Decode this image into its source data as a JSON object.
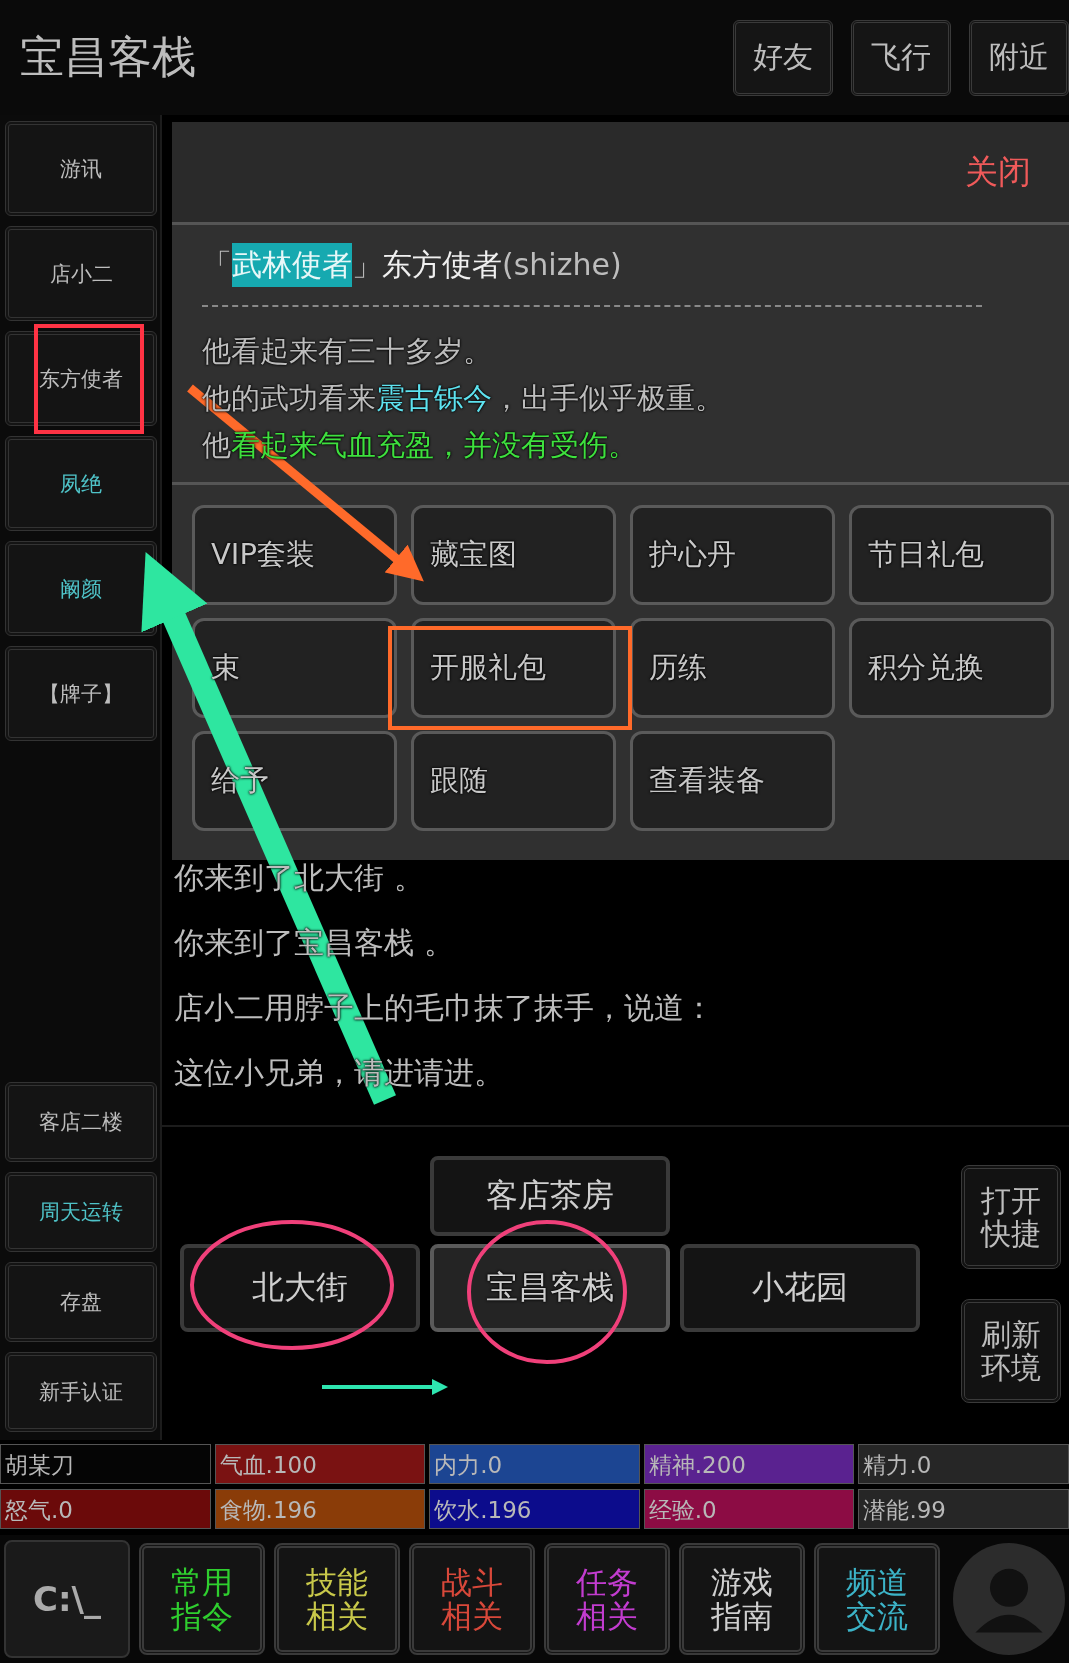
{
  "header": {
    "title": "宝昌客栈",
    "buttons": [
      "好友",
      "飞行",
      "附近"
    ]
  },
  "sidebar": {
    "top": [
      {
        "label": "游讯",
        "color": "#bdbdbd"
      },
      {
        "label": "店小二",
        "color": "#bdbdbd"
      },
      {
        "label": "东方使者",
        "color": "#bdbdbd"
      },
      {
        "label": "夙绝",
        "color": "#4fc3c8"
      },
      {
        "label": "阚颜",
        "color": "#4fc3c8"
      },
      {
        "label": "【牌子】",
        "color": "#bdbdbd"
      }
    ],
    "bottom": [
      {
        "label": "客店二楼",
        "color": "#bdbdbd"
      },
      {
        "label": "周天运转",
        "color": "#4fc3c8"
      },
      {
        "label": "存盘",
        "color": "#bdbdbd"
      },
      {
        "label": "新手认证",
        "color": "#bdbdbd"
      }
    ]
  },
  "panel": {
    "close": "关闭",
    "open_bracket": "「",
    "tag": "武林使者",
    "close_bracket": "」",
    "name": "东方使者",
    "id": "(shizhe)",
    "description": [
      [
        {
          "text": "他看起来有三十多岁。",
          "color": "#bdbdbd"
        }
      ],
      [
        {
          "text": "他的武功看来",
          "color": "#bdbdbd"
        },
        {
          "text": "震古铄今",
          "color": "#5ee3f0"
        },
        {
          "text": "，出手似乎极重。",
          "color": "#bdbdbd"
        }
      ],
      [
        {
          "text": "他",
          "color": "#bdbdbd"
        },
        {
          "text": "看起来气血充盈，并没有受伤。",
          "color": "#3ee03e"
        }
      ]
    ],
    "actions": [
      "VIP套装",
      "藏宝图",
      "护心丹",
      "节日礼包",
      "束",
      "开服礼包",
      "历练",
      "积分兑换",
      "给予",
      "跟随",
      "查看装备"
    ]
  },
  "messages": [
    "你来到了北大街 。",
    "你来到了宝昌客栈 。",
    "店小二用脖子上的毛巾抹了抹手，说道：",
    "这位小兄弟，请进请进。"
  ],
  "map": {
    "exits": [
      {
        "label": "客店茶房",
        "kind": "north",
        "selected": false
      },
      {
        "label": "北大街",
        "kind": "west",
        "selected": false
      },
      {
        "label": "宝昌客栈",
        "kind": "center",
        "selected": true
      },
      {
        "label": "小花园",
        "kind": "east",
        "selected": false
      }
    ],
    "side_buttons": [
      "打开快捷",
      "刷新环境"
    ]
  },
  "status": [
    {
      "label": "胡某刀",
      "color": "#050505"
    },
    {
      "label": "气血.100",
      "color": "#7a1212"
    },
    {
      "label": "内力.0",
      "color": "#1c4592"
    },
    {
      "label": "精神.200",
      "color": "#5a2290"
    },
    {
      "label": "精力.0",
      "color": "#262626"
    },
    {
      "label": "怒气.0",
      "color": "#6b0a0a"
    },
    {
      "label": "食物.196",
      "color": "#8a3c08"
    },
    {
      "label": "饮水.196",
      "color": "#0c0c8c"
    },
    {
      "label": "经验.0",
      "color": "#8c0c44"
    },
    {
      "label": "潜能.99",
      "color": "#262626"
    }
  ],
  "toolbar": {
    "terminal": "C:\\_",
    "buttons": [
      {
        "label": "常用指令",
        "color": "#2fcf2f"
      },
      {
        "label": "技能相关",
        "color": "#c8c84a"
      },
      {
        "label": "战斗相关",
        "color": "#d8483a"
      },
      {
        "label": "任务相关",
        "color": "#c23ccf"
      },
      {
        "label": "游戏指南",
        "color": "#cfcfcf"
      },
      {
        "label": "频道交流",
        "color": "#3cb4c8"
      }
    ]
  }
}
